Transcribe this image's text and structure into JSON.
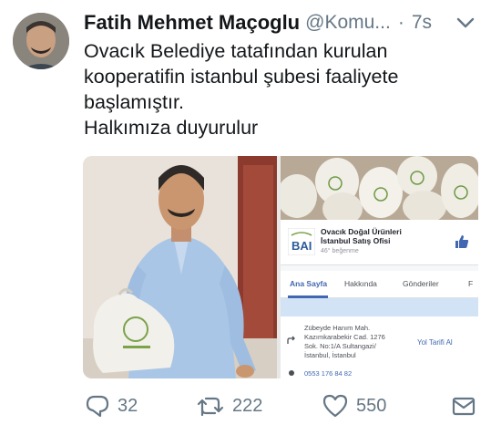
{
  "tweet": {
    "author_name": "Fatih Mehmet Maçoglu",
    "handle": "@Komu...",
    "separator": "·",
    "time": "7s",
    "text_lines": [
      "Ovacık Belediye tatafından kurulan",
      "kooperatifin istanbul şubesi faaliyete",
      "başlamıştır.",
      "Halkımıza duyurulur"
    ]
  },
  "facebook_card": {
    "page_name_line1": "Ovacık Doğal Ürünleri",
    "page_name_line2": "İstanbul Satış Ofisi",
    "likes": "46° beğenme",
    "tabs": [
      "Ana Sayfa",
      "Hakkında",
      "Gönderiler",
      "F"
    ],
    "address_lines": [
      "Zübeyde Hanım Mah.",
      "Kazımkarabekir Cad. 1276",
      "Sok. No:1/A Sultangazi/",
      "İstanbul, İstanbul"
    ],
    "directions_label": "Yol Tarifi Al",
    "phone": "0553 176 84 82"
  },
  "actions": {
    "replies": "32",
    "retweets": "222",
    "likes": "550"
  },
  "colors": {
    "text": "#14171a",
    "secondary": "#657786",
    "facebook_blue": "#4267b2"
  }
}
